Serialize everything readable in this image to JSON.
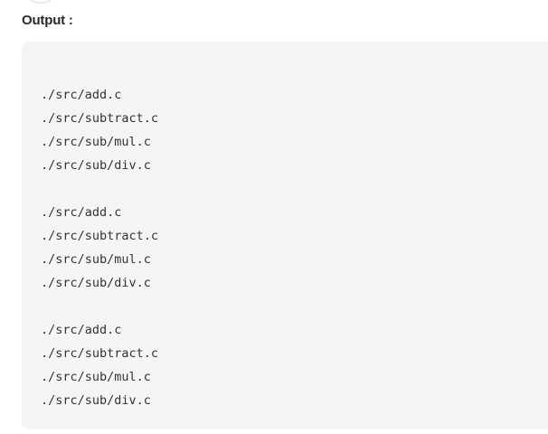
{
  "heading": "Output :",
  "output_groups": [
    [
      "./src/add.c",
      "./src/subtract.c",
      "./src/sub/mul.c",
      "./src/sub/div.c"
    ],
    [
      "./src/add.c",
      "./src/subtract.c",
      "./src/sub/mul.c",
      "./src/sub/div.c"
    ],
    [
      "./src/add.c",
      "./src/subtract.c",
      "./src/sub/mul.c",
      "./src/sub/div.c"
    ]
  ]
}
